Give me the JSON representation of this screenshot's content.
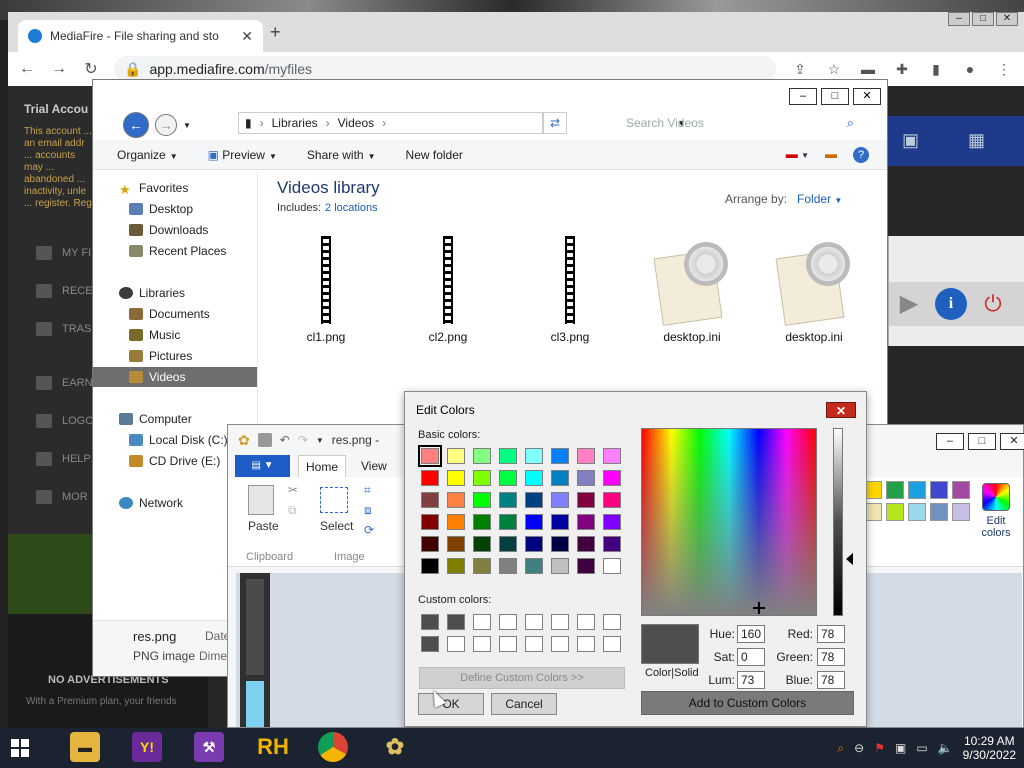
{
  "chrome": {
    "tab_title": "MediaFire - File sharing and sto",
    "url_host": "app.mediafire.com",
    "url_path": "/myfiles"
  },
  "mediafire": {
    "trial": "Trial Accou",
    "trial_text": "This account ... an email addr ... accounts may ... abandoned ... inactivity, unle ... register. Reg",
    "nav_my_files": "MY FI",
    "nav_recent": "RECE",
    "nav_trash": "TRAS",
    "nav_earn": "EARN",
    "nav_logout": "LOGO",
    "nav_help": "HELP",
    "nav_more": "MOR",
    "no_ads": "NO ADVERTISEMENTS",
    "premium": "With a Premium plan, your friends"
  },
  "explorer": {
    "breadcrumb": [
      "Libraries",
      "Videos"
    ],
    "search_placeholder": "Search Videos",
    "cmd": {
      "organize": "Organize",
      "preview": "Preview",
      "share": "Share with",
      "new_folder": "New folder"
    },
    "nav": {
      "favorites": "Favorites",
      "desktop": "Desktop",
      "downloads": "Downloads",
      "recent": "Recent Places",
      "libraries": "Libraries",
      "documents": "Documents",
      "music": "Music",
      "pictures": "Pictures",
      "videos": "Videos",
      "computer": "Computer",
      "local_disk": "Local Disk (C:)",
      "cd_drive": "CD Drive (E:)",
      "network": "Network"
    },
    "library_title": "Videos library",
    "includes_label": "Includes:",
    "includes_link": "2 locations",
    "arrange_label": "Arrange by:",
    "arrange_value": "Folder",
    "files": [
      "cl1.png",
      "cl2.png",
      "cl3.png",
      "desktop.ini",
      "desktop.ini"
    ],
    "details": {
      "name": "res.png",
      "type": "PNG image",
      "date": "Date",
      "dims": "Dime"
    }
  },
  "paint": {
    "title": "res.png -",
    "tab_home": "Home",
    "tab_view": "View",
    "paste": "Paste",
    "select": "Select",
    "group_clipboard": "Clipboard",
    "group_image": "Image",
    "edit_colors_line1": "Edit",
    "edit_colors_line2": "colors",
    "palette": [
      "#ffd700",
      "#22a04a",
      "#1ea0e0",
      "#3f48cc",
      "#a349a4",
      "#efe4b0",
      "#b5e61d",
      "#99d9ea",
      "#7092be",
      "#c8bfe7"
    ]
  },
  "edit_colors": {
    "title": "Edit Colors",
    "basic_label": "Basic colors:",
    "custom_label": "Custom colors:",
    "basic": [
      "#ff8080",
      "#ffff80",
      "#80ff80",
      "#00ff80",
      "#80ffff",
      "#0080ff",
      "#ff80c0",
      "#ff80ff",
      "#ff0000",
      "#ffff00",
      "#80ff00",
      "#00ff40",
      "#00ffff",
      "#0080c0",
      "#8080c0",
      "#ff00ff",
      "#804040",
      "#ff8040",
      "#00ff00",
      "#008080",
      "#004080",
      "#8080ff",
      "#800040",
      "#ff0080",
      "#800000",
      "#ff8000",
      "#008000",
      "#008040",
      "#0000ff",
      "#0000a0",
      "#800080",
      "#8000ff",
      "#400000",
      "#804000",
      "#004000",
      "#004040",
      "#000080",
      "#000040",
      "#400040",
      "#400080",
      "#000000",
      "#808000",
      "#808040",
      "#808080",
      "#408080",
      "#c0c0c0",
      "#400040",
      "#ffffff"
    ],
    "custom": [
      "#4e4e4e",
      "#4e4e4e",
      "#ffffff",
      "#ffffff",
      "#ffffff",
      "#ffffff",
      "#ffffff",
      "#ffffff",
      "#4e4e4e",
      "#ffffff",
      "#ffffff",
      "#ffffff",
      "#ffffff",
      "#ffffff",
      "#ffffff",
      "#ffffff"
    ],
    "define_btn": "Define Custom Colors >>",
    "ok_btn": "OK",
    "cancel_btn": "Cancel",
    "color_solid_label": "Color|Solid",
    "hue_label": "Hue:",
    "sat_label": "Sat:",
    "lum_label": "Lum:",
    "red_label": "Red:",
    "green_label": "Green:",
    "blue_label": "Blue:",
    "hue": "160",
    "sat": "0",
    "lum": "73",
    "red": "78",
    "green": "78",
    "blue": "78",
    "add_btn": "Add to Custom Colors"
  },
  "taskbar": {
    "rh_label": "RH",
    "time": "10:29 AM",
    "date": "9/30/2022"
  }
}
